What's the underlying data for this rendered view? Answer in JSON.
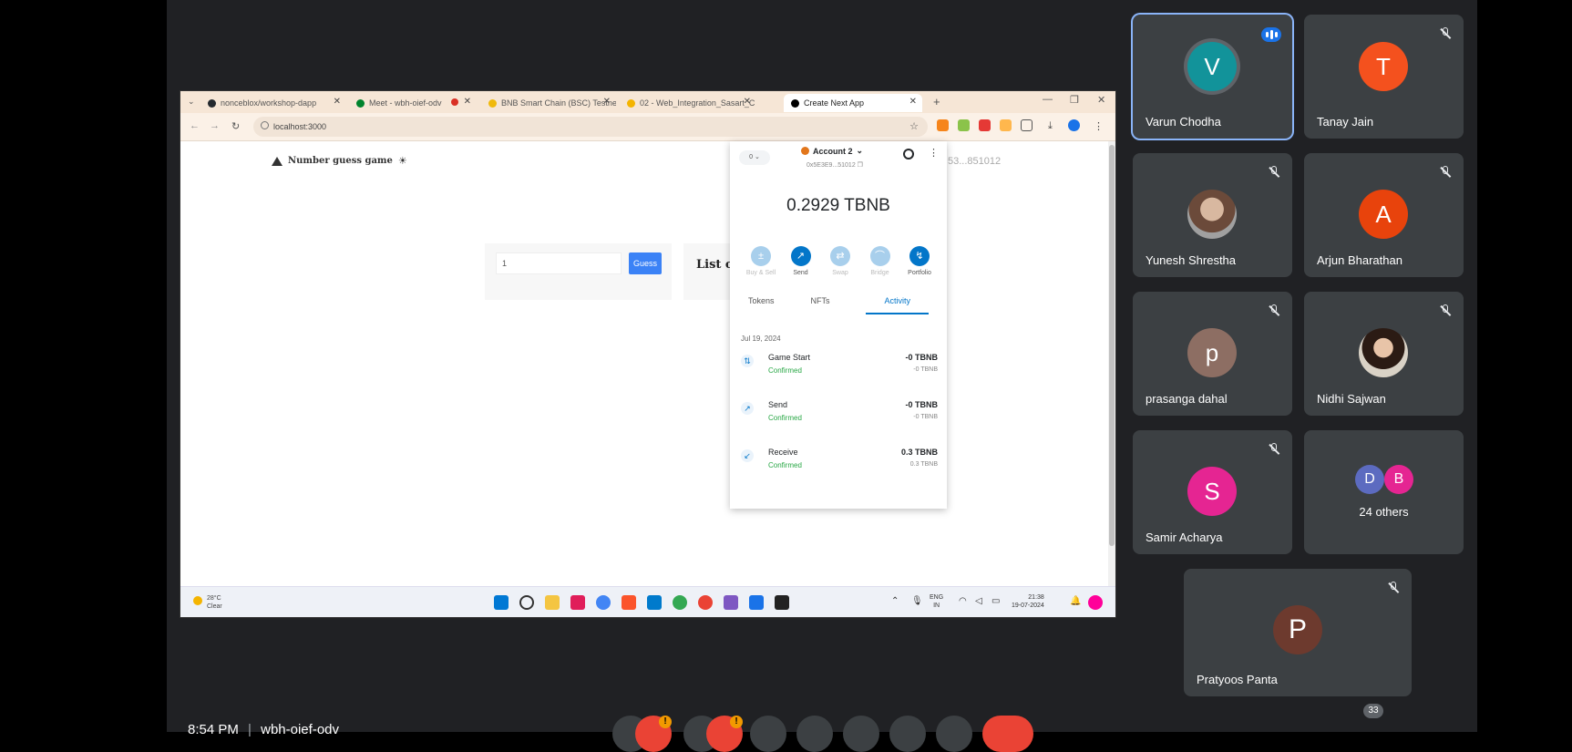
{
  "browser": {
    "tabs": [
      {
        "label": "nonceblox/workshop-dapp",
        "favicon_color": "#24292e"
      },
      {
        "label": "Meet - wbh-oief-odv",
        "favicon_color": "#00832d"
      },
      {
        "label": "BNB Smart Chain (BSC) Testnet",
        "favicon_color": "#f0b90b"
      },
      {
        "label": "02 - Web_Integration_Sasart_C",
        "favicon_color": "#f4b400"
      },
      {
        "label": "Create Next App",
        "favicon_color": "#000000"
      }
    ],
    "url": "localhost:3000"
  },
  "app": {
    "title": "Number guess game",
    "input_value": "1",
    "guess_button": "Guess",
    "list_title": "List o",
    "address_suffix": "53...851012"
  },
  "wallet": {
    "network": "0",
    "account_name": "Account 2",
    "account_address": "0x5E3E9...51012",
    "balance": "0.2929 TBNB",
    "actions": [
      {
        "label": "Buy & Sell",
        "icon": "buy-sell-icon",
        "glyph": "±"
      },
      {
        "label": "Send",
        "icon": "send-icon",
        "glyph": "↗"
      },
      {
        "label": "Swap",
        "icon": "swap-icon",
        "glyph": "⇄"
      },
      {
        "label": "Bridge",
        "icon": "bridge-icon",
        "glyph": "⌒"
      },
      {
        "label": "Portfolio",
        "icon": "portfolio-icon",
        "glyph": "↯"
      }
    ],
    "tabs": [
      "Tokens",
      "NFTs",
      "Activity"
    ],
    "date": "Jul 19, 2024",
    "transactions": [
      {
        "name": "Game Start",
        "status": "Confirmed",
        "amount": "-0 TBNB",
        "sub_amount": "-0 TBNB",
        "glyph": "⇅"
      },
      {
        "name": "Send",
        "status": "Confirmed",
        "amount": "-0 TBNB",
        "sub_amount": "-0 TBNB",
        "glyph": "↗"
      },
      {
        "name": "Receive",
        "status": "Confirmed",
        "amount": "0.3 TBNB",
        "sub_amount": "0.3 TBNB",
        "glyph": "↙"
      }
    ]
  },
  "taskbar": {
    "temperature": "28°C",
    "weather": "Clear",
    "language": "ENG",
    "region": "IN",
    "time": "21:38",
    "date": "19-07-2024"
  },
  "participants": [
    {
      "name": "Varun Chodha",
      "initial": "V",
      "color": "#12939a",
      "state": "speaking"
    },
    {
      "name": "Tanay Jain",
      "initial": "T",
      "color": "#f4511e",
      "state": "muted"
    },
    {
      "name": "Yunesh Shrestha",
      "initial": "",
      "color": "#8d6e63",
      "state": "muted"
    },
    {
      "name": "Arjun Bharathan",
      "initial": "A",
      "color": "#e8430c",
      "state": "muted"
    },
    {
      "name": "prasanga dahal",
      "initial": "p",
      "color": "#8d6e63",
      "state": "muted"
    },
    {
      "name": "Nidhi Sajwan",
      "initial": "",
      "color": "#6d4c41",
      "state": "muted"
    },
    {
      "name": "Samir Acharya",
      "initial": "S",
      "color": "#e52592",
      "state": "muted"
    },
    {
      "name": "24 others",
      "initials": [
        "D",
        "B"
      ],
      "colors": [
        "#5c6bc0",
        "#e52592"
      ]
    },
    {
      "name": "Pratyoos Panta",
      "initial": "P",
      "color": "#6d3a2e",
      "state": "muted"
    }
  ],
  "meeting": {
    "time": "8:54 PM",
    "code": "wbh-oief-odv",
    "participant_count": "33",
    "badge": "!"
  }
}
